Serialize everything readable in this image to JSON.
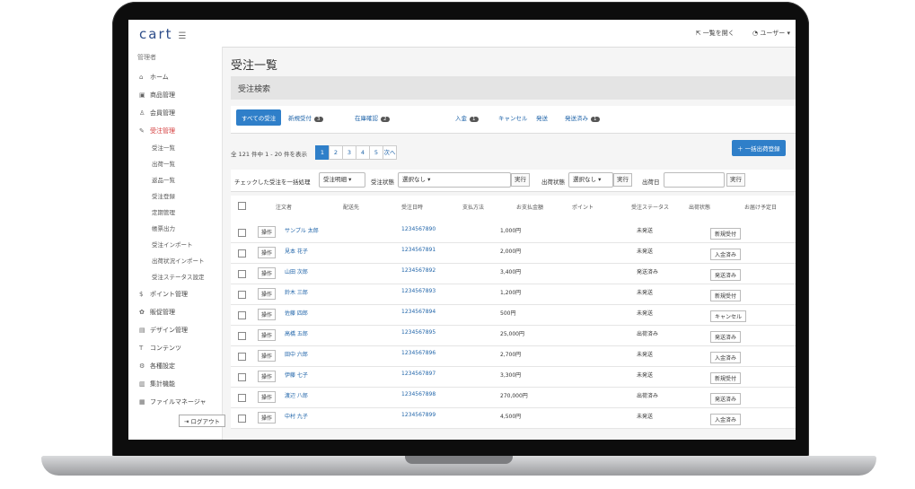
{
  "app": {
    "logo": "cart"
  },
  "topbar": {
    "link1": "一覧を開く",
    "user": "ユーザー"
  },
  "sidebar": {
    "header": "管理者",
    "items": [
      {
        "icon": "home-icon",
        "label": "ホーム"
      },
      {
        "icon": "products-icon",
        "label": "商品管理"
      },
      {
        "icon": "members-icon",
        "label": "会員管理"
      },
      {
        "icon": "orders-icon",
        "label": "受注管理",
        "active": true
      }
    ],
    "subitems": [
      "受注一覧",
      "出荷一覧",
      "返品一覧",
      "受注登録",
      "定期管理",
      "帳票出力",
      "受注インポート",
      "出荷状況インポート",
      "受注ステータス設定"
    ],
    "items2": [
      {
        "icon": "point-icon",
        "label": "ポイント管理"
      },
      {
        "icon": "promo-icon",
        "label": "販促管理"
      },
      {
        "icon": "design-icon",
        "label": "デザイン管理"
      },
      {
        "icon": "content-icon",
        "label": "コンテンツ"
      },
      {
        "icon": "settings-icon",
        "label": "各種設定"
      },
      {
        "icon": "report-icon",
        "label": "集計機能"
      },
      {
        "icon": "file-icon",
        "label": "ファイルマネージャ"
      }
    ],
    "logout": "ログアウト"
  },
  "page": {
    "title": "受注一覧",
    "search_panel": "受注検索"
  },
  "tabs": [
    {
      "label": "すべての受注",
      "active": true
    },
    {
      "label": "新規受付",
      "badge": "3"
    },
    {
      "label": "在庫確認",
      "badge": "2"
    },
    {
      "label": "入金",
      "badge": "1"
    },
    {
      "label": "キャンセル"
    },
    {
      "label": "発送"
    },
    {
      "label": "発送済み",
      "badge": "1"
    }
  ],
  "listing": {
    "count": "全 121 件中 1 - 20 件を表示",
    "pages": [
      "1",
      "2",
      "3",
      "4",
      "5",
      "次へ"
    ],
    "bulk_button": "一括出荷登録"
  },
  "toolbar": {
    "csv": "チェックした受注を一括処理",
    "csv_select": "受注明細",
    "status_label": "受注状態",
    "status_value": "選択なし",
    "exec1": "実行",
    "ship_label": "出荷状態",
    "ship_value": "選択なし",
    "exec2": "実行",
    "date_label": "出荷日",
    "exec3": "実行"
  },
  "columns": [
    "注文者",
    "配送先",
    "受注日時",
    "支払方法",
    "お支払金額",
    "ポイント",
    "受注ステータス",
    "出荷状態",
    "お届け予定日"
  ],
  "rows": [
    {
      "op": "操作",
      "name": "サンプル 太郎",
      "date": "1234567890",
      "amount": "1,000円",
      "ship": "未発送",
      "status": "新規受付"
    },
    {
      "op": "操作",
      "name": "見本 花子",
      "date": "1234567891",
      "amount": "2,000円",
      "ship": "未発送",
      "status": "入金済み"
    },
    {
      "op": "操作",
      "name": "山田 次郎",
      "date": "1234567892",
      "amount": "3,400円",
      "ship": "発送済み",
      "status": "発送済み"
    },
    {
      "op": "操作",
      "name": "鈴木 三郎",
      "date": "1234567893",
      "amount": "1,200円",
      "ship": "未発送",
      "status": "新規受付"
    },
    {
      "op": "操作",
      "name": "佐藤 四郎",
      "date": "1234567894",
      "amount": "500円",
      "ship": "未発送",
      "status": "キャンセル"
    },
    {
      "op": "操作",
      "name": "高橋 五郎",
      "date": "1234567895",
      "amount": "25,000円",
      "ship": "出荷済み",
      "status": "発送済み"
    },
    {
      "op": "操作",
      "name": "田中 六郎",
      "date": "1234567896",
      "amount": "2,700円",
      "ship": "未発送",
      "status": "入金済み"
    },
    {
      "op": "操作",
      "name": "伊藤 七子",
      "date": "1234567897",
      "amount": "3,300円",
      "ship": "未発送",
      "status": "新規受付"
    },
    {
      "op": "操作",
      "name": "渡辺 八郎",
      "date": "1234567898",
      "amount": "270,000円",
      "ship": "出荷済み",
      "status": "発送済み"
    },
    {
      "op": "操作",
      "name": "中村 九子",
      "date": "1234567899",
      "amount": "4,500円",
      "ship": "未発送",
      "status": "入金済み"
    }
  ]
}
